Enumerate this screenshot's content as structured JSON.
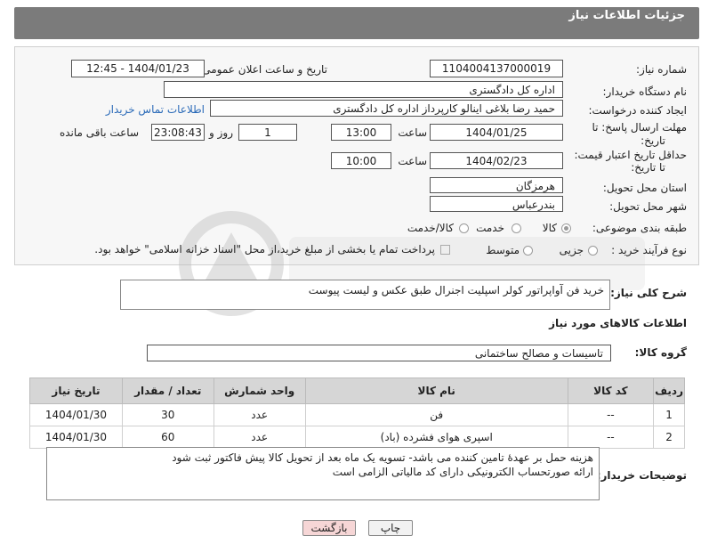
{
  "page": {
    "title": "جزئیات اطلاعات نیاز"
  },
  "fields": {
    "need_number_label": "شماره نیاز:",
    "need_number": "1104004137000019",
    "announce_label": "تاریخ و ساعت اعلان عمومی:",
    "announce_value": "1404/01/23 - 12:45",
    "buyer_org_label": "نام دستگاه خریدار:",
    "buyer_org": "اداره کل دادگستری",
    "requester_label": "ایجاد کننده درخواست:",
    "requester": "حمید رضا  بلاغی اینالو کارپرداز اداره کل دادگستری",
    "contact_link": "اطلاعات تماس خریدار",
    "deadline_label_1": "مهلت ارسال پاسخ: تا",
    "deadline_label_2": "تاریخ:",
    "deadline_date": "1404/01/25",
    "time_label": "ساعت",
    "deadline_time": "13:00",
    "days_value": "1",
    "days_label": "روز و",
    "remaining_time": "23:08:43",
    "remaining_label": "ساعت باقی مانده",
    "min_validity_label_1": "حداقل تاریخ اعتبار قیمت:",
    "min_validity_label_2": "تا تاریخ:",
    "validity_date": "1404/02/23",
    "validity_time_label": "ساعت",
    "validity_time": "10:00",
    "province_label": "استان محل تحویل:",
    "province": "هرمزگان",
    "city_label": "شهر محل تحویل:",
    "city": "بندرعباس",
    "category_label": "طبقه بندی موضوعی:",
    "category_options": [
      "کالا",
      "خدمت",
      "کالا/خدمت"
    ],
    "category_selected": "کالا",
    "process_label": "نوع فرآیند خرید :",
    "process_options": [
      "جزیی",
      "متوسط"
    ],
    "payment_note": "پرداخت تمام یا بخشی از مبلغ خرید،از محل \"اسناد خزانه اسلامی\" خواهد بود."
  },
  "description": {
    "label": "شرح کلی نیاز:",
    "text": "خرید فن آواپراتور کولر اسپلیت اجنرال طبق عکس و لیست پیوست"
  },
  "goods_info": {
    "title": "اطلاعات کالاهای مورد نیاز",
    "group_label": "گروه کالا:",
    "group_value": "تاسیسات و مصالح ساختمانی"
  },
  "table": {
    "headers": [
      "ردیف",
      "کد کالا",
      "نام کالا",
      "واحد شمارش",
      "تعداد / مقدار",
      "تاریخ نیاز"
    ],
    "rows": [
      [
        "1",
        "--",
        "فن",
        "عدد",
        "30",
        "1404/01/30"
      ],
      [
        "2",
        "--",
        "اسپری هوای فشرده (باد)",
        "عدد",
        "60",
        "1404/01/30"
      ]
    ]
  },
  "buyer_notes": {
    "label": "توضیحات خریدار:",
    "line1": "هزینه حمل بر عهدۀ تامین کننده می باشد- تسویه یک ماه بعد از تحویل کالا پیش فاکتور ثبت شود",
    "line2": "ارائه صورتحساب الکترونیکی دارای کد مالیاتی الزامی است"
  },
  "buttons": {
    "print": "چاپ",
    "back": "بازگشت"
  },
  "colors": {
    "header_bg": "#7b7b7b",
    "link": "#2a6ab8",
    "back_button_bg": "#f6d6d6",
    "print_button_bg": "#f2f2f2"
  }
}
